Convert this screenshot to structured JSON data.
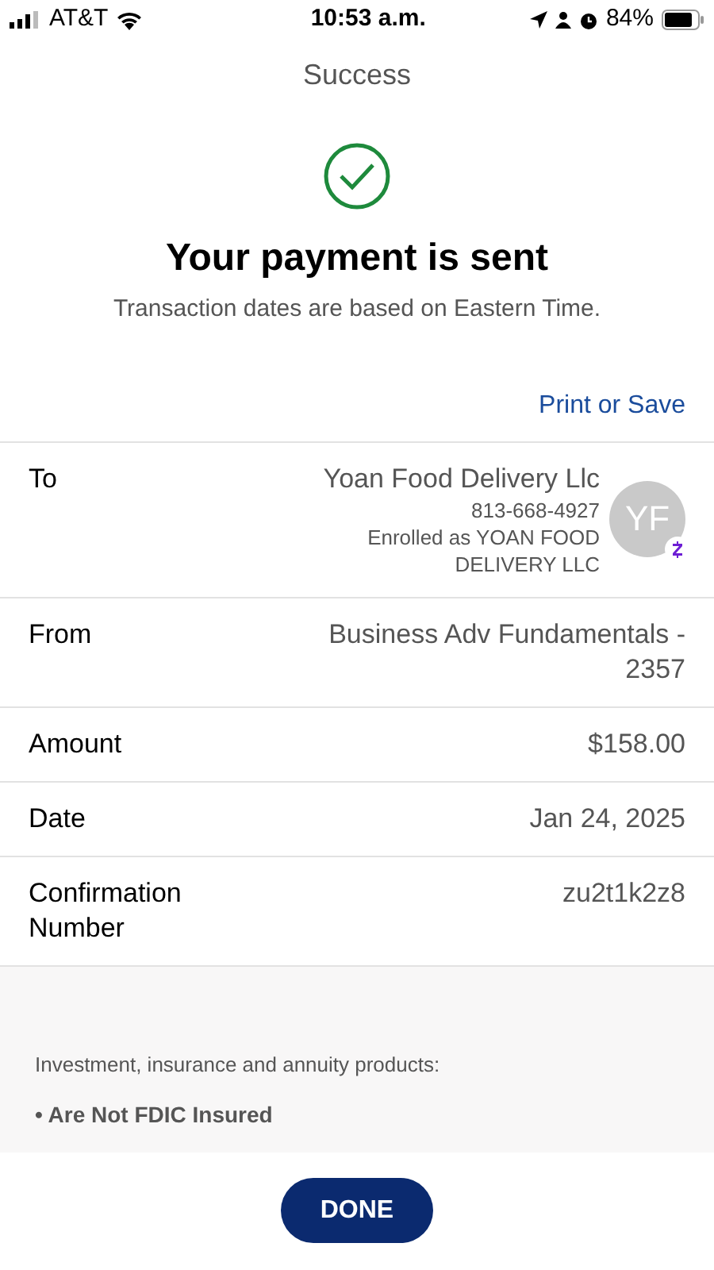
{
  "status_bar": {
    "carrier": "AT&T",
    "time": "10:53 a.m.",
    "battery": "84%"
  },
  "title": "Success",
  "heading": "Your payment is sent",
  "subheading": "Transaction dates are based on Eastern Time.",
  "print_link": "Print or Save",
  "rows": [
    {
      "label": "To",
      "value": "Yoan Food Delivery Llc",
      "details": [
        "813-668-4927",
        "Enrolled as YOAN FOOD DELIVERY LLC"
      ],
      "avatar": "YF"
    },
    {
      "label": "From",
      "value": "Business Adv Fundamentals - 2357"
    },
    {
      "label": "Amount",
      "value": "$158.00"
    },
    {
      "label": "Date",
      "value": "Jan 24, 2025"
    },
    {
      "label": "Confirmation Number",
      "value": "zu2t1k2z8"
    }
  ],
  "disclaimer": {
    "intro": "Investment, insurance and annuity products:",
    "bullets": [
      "• Are Not FDIC Insured"
    ]
  },
  "done_button": "DONE"
}
